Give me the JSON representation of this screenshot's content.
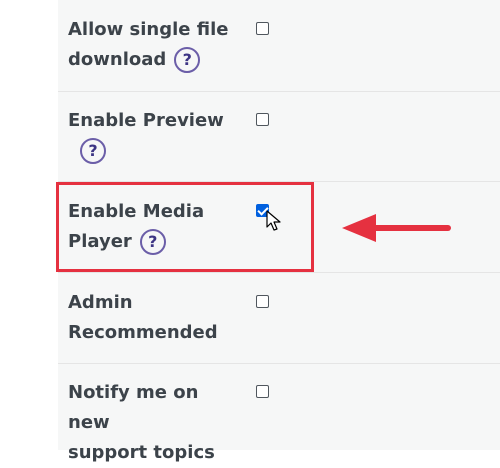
{
  "settings": [
    {
      "label_line1": "Allow single file",
      "label_line2": "download",
      "help": "?",
      "checked": false
    },
    {
      "label_line1": "Enable Preview",
      "label_line2": "",
      "help": "?",
      "checked": false
    },
    {
      "label_line1": "Enable Media",
      "label_line2": "Player",
      "help": "?",
      "checked": true
    },
    {
      "label_line1": "Admin",
      "label_line2": "Recommended",
      "help": "",
      "checked": false
    },
    {
      "label_line1": "Notify me on new",
      "label_line2": "support topics",
      "help": "",
      "checked": false
    }
  ],
  "colors": {
    "highlight": "#e53140",
    "arrow": "#e53140",
    "checkbox_checked": "#0060df",
    "help_circle": "#6b5ea8"
  },
  "icons": {
    "help": "question-circle-icon",
    "arrow": "arrow-left-icon",
    "cursor": "mouse-pointer-icon"
  }
}
